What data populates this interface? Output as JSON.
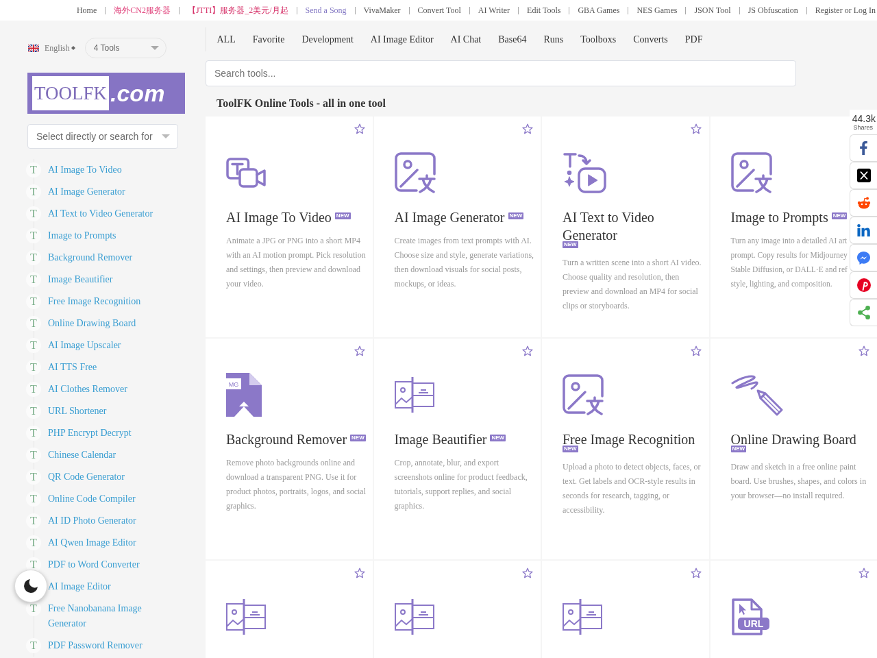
{
  "top_nav": {
    "links": [
      {
        "label": "Home",
        "color": "#555555"
      },
      {
        "label": "海外CN2服务器",
        "color": "#e0407a"
      },
      {
        "label": "【JTTI】服务器_2美元/月起",
        "color": "#d63068"
      },
      {
        "label": "Send a Song",
        "color": "#8479c4"
      },
      {
        "label": "VivaMaker",
        "color": "#555555"
      },
      {
        "label": "Convert Tool",
        "color": "#555555"
      },
      {
        "label": "AI Writer",
        "color": "#555555"
      },
      {
        "label": "Edit Tools",
        "color": "#555555"
      },
      {
        "label": "GBA Games",
        "color": "#555555"
      },
      {
        "label": "NES Games",
        "color": "#555555"
      },
      {
        "label": "JSON Tool",
        "color": "#555555"
      },
      {
        "label": "JS Obfuscation",
        "color": "#555555"
      },
      {
        "label": "Register or Log In",
        "color": "#555555"
      }
    ]
  },
  "sidebar": {
    "language": {
      "label": "English"
    },
    "tools_select": {
      "value": "4 Tools"
    },
    "logo": {
      "name": "TOOLFK",
      "domain": ".com"
    },
    "tool_search": {
      "placeholder": "Select directly or search for"
    },
    "items": [
      {
        "badge": "T",
        "label": "AI Image To Video"
      },
      {
        "badge": "T",
        "label": "AI Image Generator"
      },
      {
        "badge": "T",
        "label": "AI Text to Video Generator"
      },
      {
        "badge": "T",
        "label": "Image to Prompts"
      },
      {
        "badge": "T",
        "label": "Background Remover"
      },
      {
        "badge": "T",
        "label": "Image Beautifier"
      },
      {
        "badge": "T",
        "label": "Free Image Recognition"
      },
      {
        "badge": "T",
        "label": "Online Drawing Board"
      },
      {
        "badge": "T",
        "label": "AI Image Upscaler"
      },
      {
        "badge": "T",
        "label": "AI TTS Free"
      },
      {
        "badge": "T",
        "label": "AI Clothes Remover"
      },
      {
        "badge": "T",
        "label": "URL Shortener"
      },
      {
        "badge": "T",
        "label": "PHP Encrypt Decrypt"
      },
      {
        "badge": "T",
        "label": "Chinese Calendar"
      },
      {
        "badge": "T",
        "label": "QR Code Generator"
      },
      {
        "badge": "T",
        "label": "Online Code Compiler"
      },
      {
        "badge": "T",
        "label": "AI ID Photo Generator"
      },
      {
        "badge": "T",
        "label": "AI Qwen Image Editor"
      },
      {
        "badge": "T",
        "label": "PDF to Word Converter"
      },
      {
        "label": "AI Image Editor"
      },
      {
        "badge": "T",
        "label": "Free Nanobanana Image Generator"
      },
      {
        "badge": "T",
        "label": "PDF Password Remover"
      }
    ]
  },
  "tabs": [
    {
      "label": "ALL"
    },
    {
      "label": "Favorite"
    },
    {
      "label": "Development"
    },
    {
      "label": "AI Image Editor"
    },
    {
      "label": "AI Chat"
    },
    {
      "label": "Base64"
    },
    {
      "label": "Runs"
    },
    {
      "label": "Toolboxs"
    },
    {
      "label": "Converts"
    },
    {
      "label": "PDF"
    }
  ],
  "search": {
    "placeholder": "Search tools..."
  },
  "heading": "ToolFK Online Tools - all in one tool",
  "cards": [
    {
      "kind": "textvideo",
      "title": "AI Image To Video",
      "badge": "NEW",
      "description": "Animate a JPG or PNG into a short MP4 with an AI motion prompt. Pick resolution and settings, then preview and download your video.",
      "starred": false
    },
    {
      "kind": "imagetext",
      "title": "AI Image Generator",
      "badge": "NEW",
      "description": "Create images from text prompts with AI. Choose size and style, generate variations, then download visuals for social posts, mockups, or ideas.",
      "starred": false
    },
    {
      "kind": "textplay",
      "title": "AI Text to Video Generator",
      "badge": "NEW",
      "description": "Turn a written scene into a short AI video. Choose quality and resolution, then preview and download an MP4 for social clips or storyboards.",
      "starred": false
    },
    {
      "kind": "imagetext",
      "title": "Image to Prompts",
      "badge": "NEW",
      "description": "Turn any image into a detailed AI art prompt. Copy results for Midjourney Stable Diffusion, or DALL·E and ref style, lighting, and composition."
    },
    {
      "kind": "imagefile",
      "icon_label": "MG",
      "title": "Background Remover",
      "badge": "NEW",
      "description": "Remove photo backgrounds online and download a transparent PNG. Use it for product photos, portraits, logos, and social graphics.",
      "starred": false
    },
    {
      "kind": "beautify",
      "title": "Image Beautifier",
      "badge": "NEW",
      "description": "Crop, annotate, blur, and export screenshots online for product feedback, tutorials, support replies, and social graphics.",
      "starred": false
    },
    {
      "kind": "imagetext",
      "title": "Free Image Recognition",
      "badge": "NEW",
      "description": "Upload a photo to detect objects, faces, or text. Get labels and OCR-style results in seconds for research, tagging, or accessibility.",
      "starred": false
    },
    {
      "kind": "sketch",
      "title": "Online Drawing Board",
      "badge": "NEW",
      "description": "Draw and sketch in a free online paint board. Use brushes, shapes, and colors in your browser—no install required.",
      "starred": false
    },
    {
      "kind": "beautify",
      "starred": false
    },
    {
      "kind": "beautify",
      "starred": false
    },
    {
      "kind": "beautify",
      "starred": false
    },
    {
      "kind": "urlfile",
      "icon_label": "URL",
      "starred": false
    }
  ],
  "share_bar": {
    "count": "44.3k",
    "label": "Shares",
    "buttons": [
      {
        "kind": "facebook"
      },
      {
        "kind": "x"
      },
      {
        "kind": "reddit"
      },
      {
        "kind": "linkedin"
      },
      {
        "kind": "messenger"
      },
      {
        "kind": "pinterest"
      },
      {
        "kind": "share"
      }
    ]
  }
}
